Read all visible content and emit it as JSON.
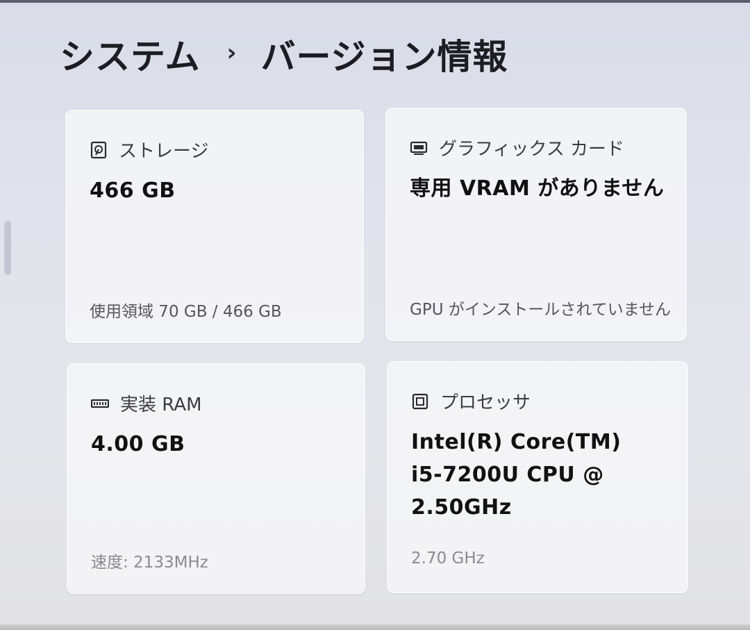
{
  "breadcrumb": {
    "parent": "システム",
    "separator": "›",
    "current": "バージョン情報"
  },
  "cards": {
    "storage": {
      "icon": "storage-drive-icon",
      "label": "ストレージ",
      "value": "466 GB",
      "detail": "使用領域 70 GB / 466 GB"
    },
    "graphics": {
      "icon": "display-icon",
      "label": "グラフィックス カード",
      "value": "専用 VRAM がありません",
      "detail": "GPU がインストールされていません"
    },
    "ram": {
      "icon": "memory-module-icon",
      "label": "実装 RAM",
      "value": "4.00 GB",
      "detail": "速度: 2133MHz"
    },
    "processor": {
      "icon": "processor-chip-icon",
      "label": "プロセッサ",
      "value_lines": [
        "Intel(R) Core(TM)",
        "i5-7200U CPU @",
        "2.50GHz"
      ],
      "detail": "2.70 GHz"
    }
  }
}
